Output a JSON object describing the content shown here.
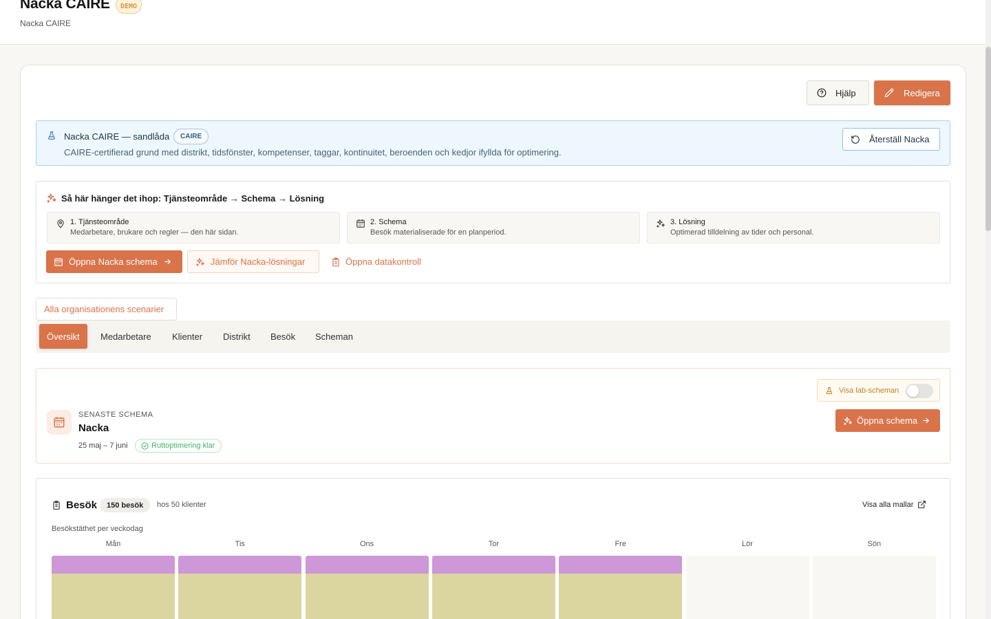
{
  "header": {
    "title": "Nacka CAIRE",
    "badge": "DEMO",
    "subtitle": "Nacka CAIRE"
  },
  "actions": {
    "help": "Hjälp",
    "edit": "Redigera"
  },
  "sandbox": {
    "title": "Nacka CAIRE — sandlåda",
    "badge": "CAIRE",
    "description": "CAIRE-certifierad grund med distrikt, tidsfönster, kompetenser, taggar, kontinuitet, beroenden och kedjor ifyllda för optimering.",
    "reset": "Återställ Nacka"
  },
  "howto": {
    "title": "Så här hänger det ihop: Tjänsteområde → Schema → Lösning",
    "steps": [
      {
        "title": "1. Tjänsteområde",
        "desc": "Medarbetare, brukare och regler — den här sidan."
      },
      {
        "title": "2. Schema",
        "desc": "Besök materialiserade för en planperiod."
      },
      {
        "title": "3. Lösning",
        "desc": "Optimerad tilldelning av tider och personal."
      }
    ],
    "open_schedule": "Öppna Nacka schema",
    "compare": "Jämför Nacka-lösningar",
    "data_control": "Öppna datakontroll"
  },
  "all_scenarios": "Alla organisationens scenarier",
  "tabs": [
    "Översikt",
    "Medarbetare",
    "Klienter",
    "Distrikt",
    "Besök",
    "Scheman"
  ],
  "latest": {
    "lab_toggle": "Visa lab-scheman",
    "label": "SENASTE SCHEMA",
    "name": "Nacka",
    "dates": "25 maj – 7 juni",
    "status": "Ruttoptimering klar",
    "open": "Öppna schema"
  },
  "visits": {
    "title": "Besök",
    "count_badge": "150 besök",
    "clients": "hos 50 klienter",
    "all_templates": "Visa alla mallar",
    "density_label": "Besökstäthet per veckodag",
    "days": [
      {
        "label": "Mån",
        "top_frac": 0.22,
        "filled": true
      },
      {
        "label": "Tis",
        "top_frac": 0.22,
        "filled": true
      },
      {
        "label": "Ons",
        "top_frac": 0.22,
        "filled": true
      },
      {
        "label": "Tor",
        "top_frac": 0.22,
        "filled": true
      },
      {
        "label": "Fre",
        "top_frac": 0.22,
        "filled": true
      },
      {
        "label": "Lör",
        "top_frac": 0,
        "filled": false
      },
      {
        "label": "Sön",
        "top_frac": 0,
        "filled": false
      }
    ]
  },
  "colors": {
    "accent": "#d9734a",
    "info": "#a9d3ef",
    "success": "#43b16d",
    "segment_top": "#cd97d8",
    "segment_bottom": "#dbd69f"
  }
}
